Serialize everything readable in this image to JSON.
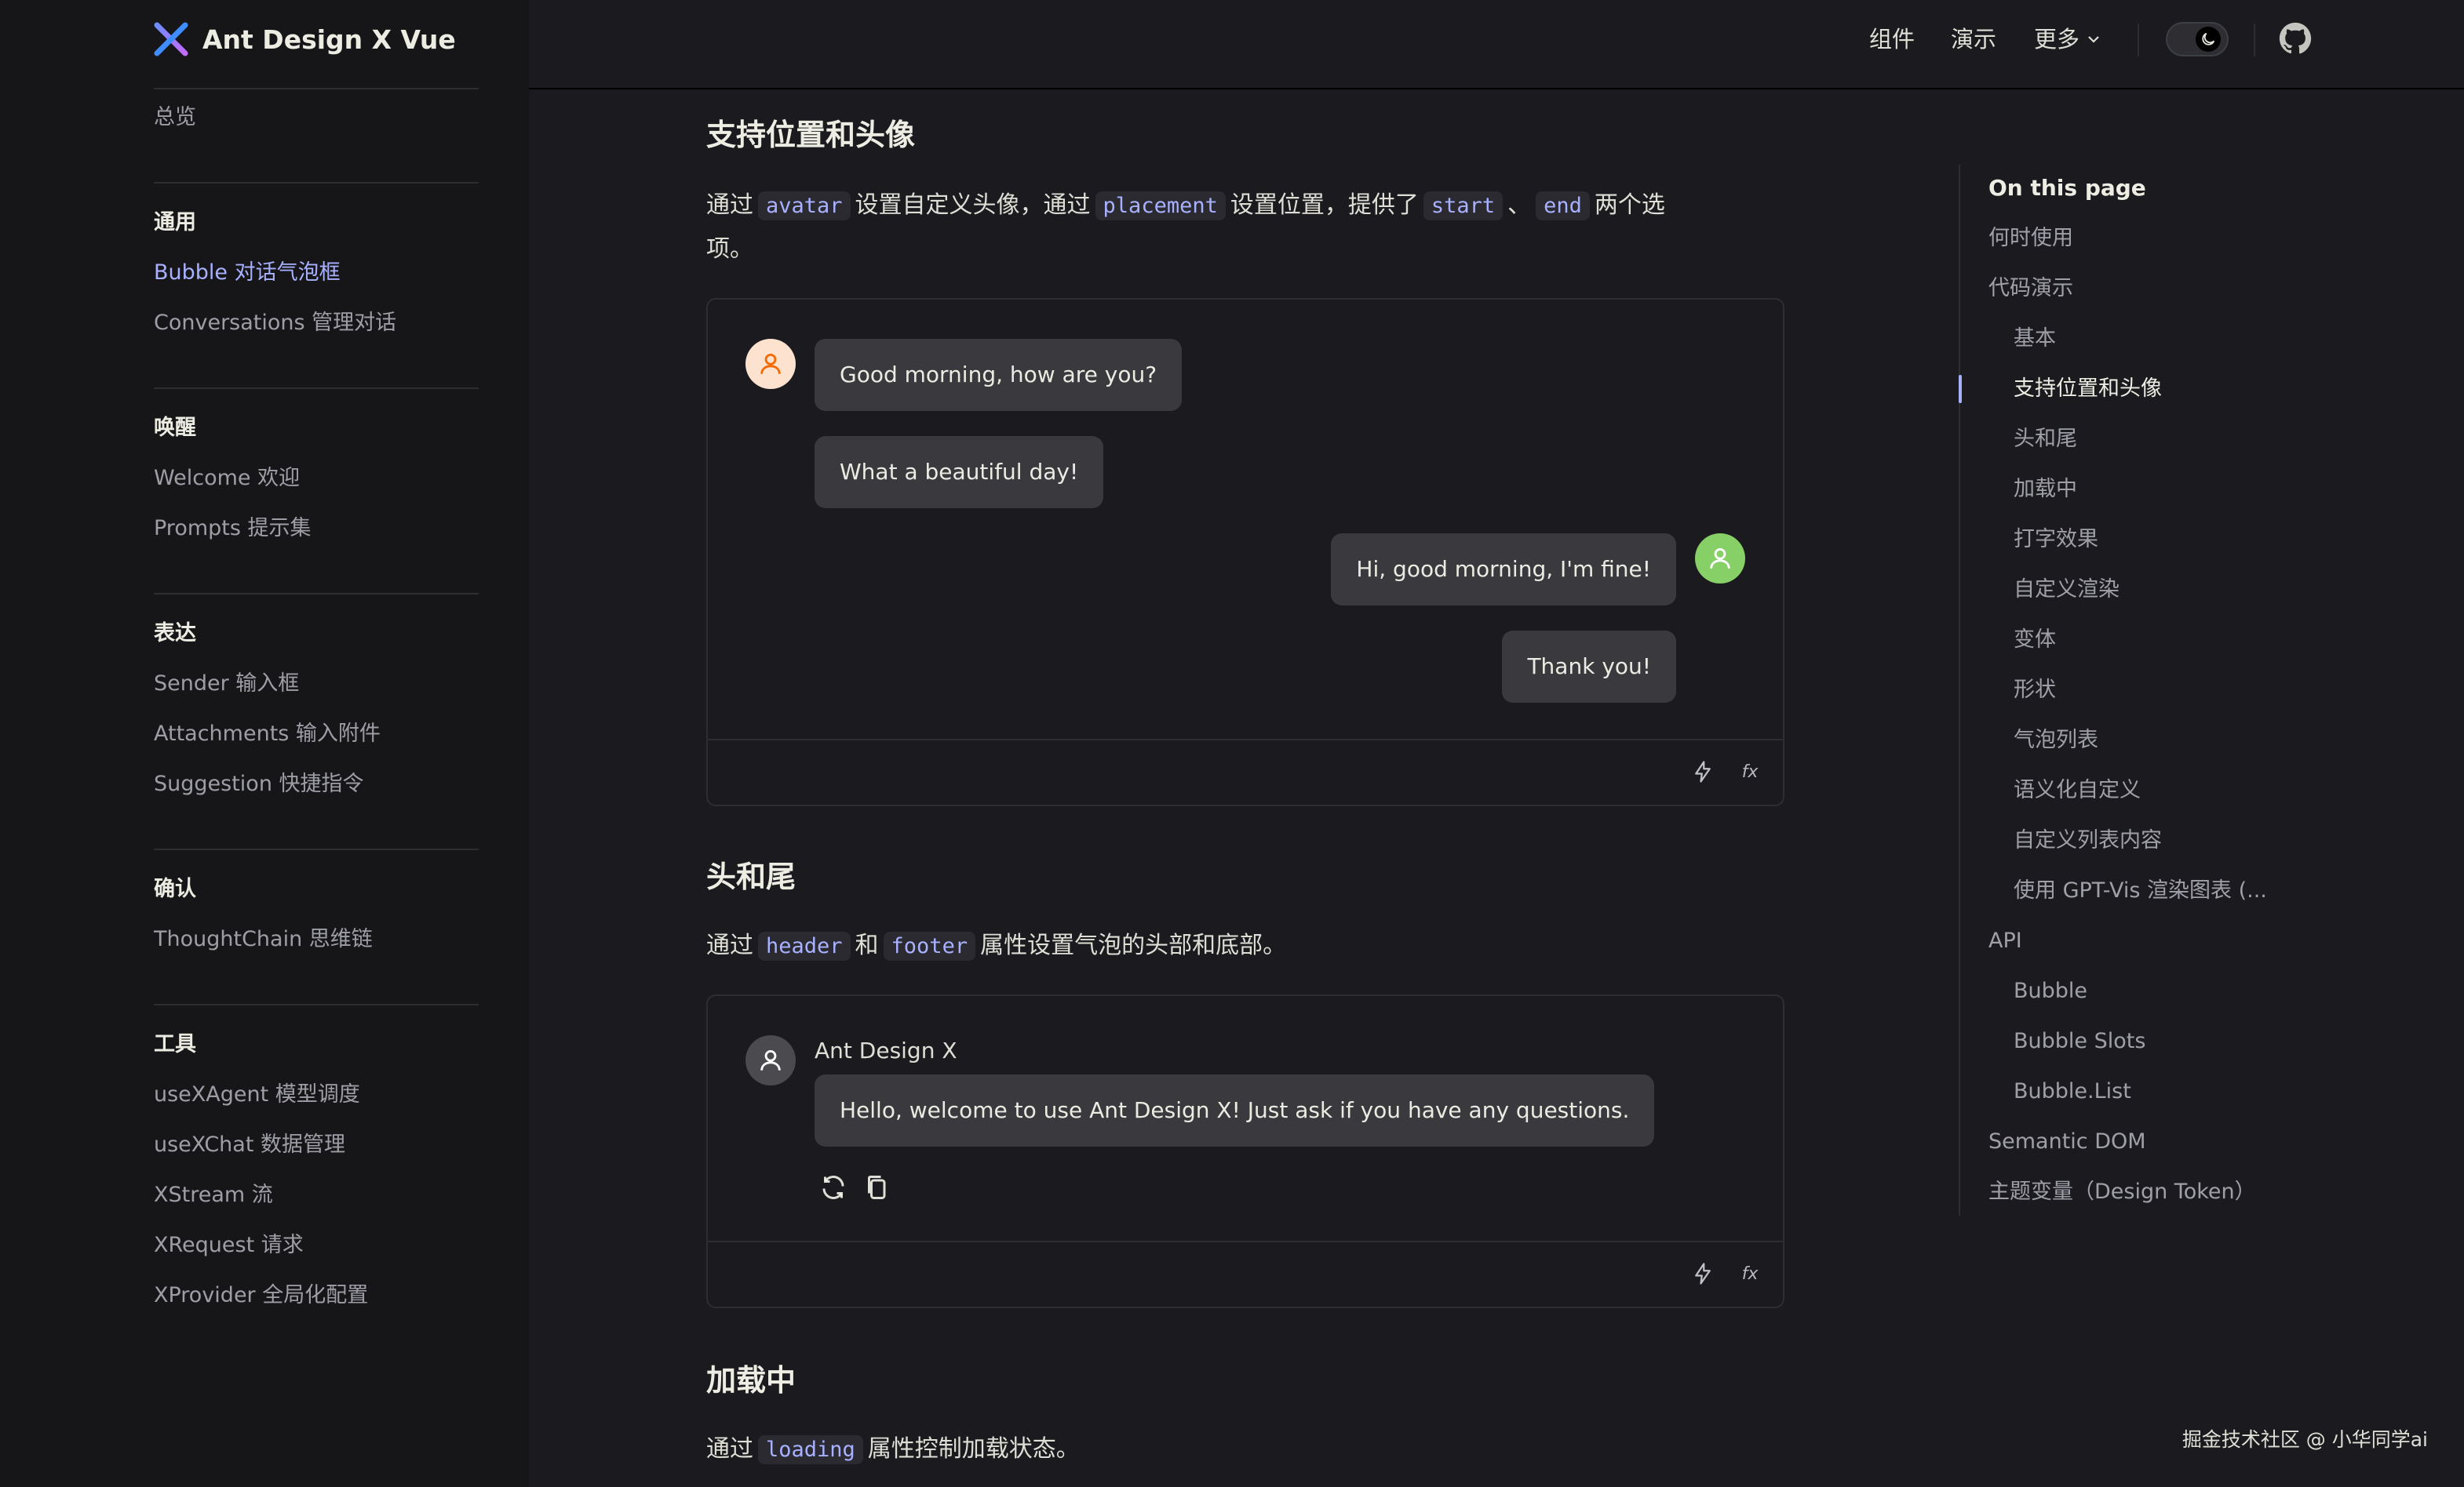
{
  "app": {
    "title": "Ant Design X Vue",
    "logo_icon": "ant-x-logo"
  },
  "sidebar": {
    "overview": "总览",
    "groups": [
      {
        "title": "通用",
        "items": [
          "Bubble 对话气泡框",
          "Conversations 管理对话"
        ]
      },
      {
        "title": "唤醒",
        "items": [
          "Welcome 欢迎",
          "Prompts 提示集"
        ]
      },
      {
        "title": "表达",
        "items": [
          "Sender 输入框",
          "Attachments 输入附件",
          "Suggestion 快捷指令"
        ]
      },
      {
        "title": "确认",
        "items": [
          "ThoughtChain 思维链"
        ]
      },
      {
        "title": "工具",
        "items": [
          "useXAgent 模型调度",
          "useXChat 数据管理",
          "XStream 流",
          "XRequest 请求",
          "XProvider 全局化配置"
        ]
      }
    ],
    "active_item": "Bubble 对话气泡框"
  },
  "topnav": {
    "items": [
      "组件",
      "演示",
      "更多"
    ],
    "theme_toggle_icon": "moon-icon",
    "github_icon": "github-icon"
  },
  "sections": {
    "placement": {
      "title": "支持位置和头像",
      "desc_1": "通过",
      "code_1": "avatar",
      "desc_2": "设置自定义头像，通过",
      "code_2": "placement",
      "desc_3": "设置位置，提供了",
      "code_3": "start",
      "desc_4": "、",
      "code_4": "end",
      "desc_5": "两个选",
      "desc_6": "项。",
      "messages": [
        "Good morning, how are you?",
        "What a beautiful day!",
        "Hi, good morning, I'm fine!",
        "Thank you!"
      ]
    },
    "header_footer": {
      "title": "头和尾",
      "desc_1": "通过",
      "code_1": "header",
      "desc_2": "和",
      "code_2": "footer",
      "desc_3": "属性设置气泡的头部和底部。",
      "header_text": "Ant Design X",
      "message": "Hello, welcome to use Ant Design X! Just ask if you have any questions."
    },
    "loading": {
      "title": "加载中",
      "desc_1": "通过",
      "code_1": "loading",
      "desc_2": "属性控制加载状态。"
    },
    "demo_footer_fx": "fx"
  },
  "toc": {
    "title": "On this page",
    "items": [
      "何时使用",
      "代码演示",
      "基本",
      "支持位置和头像",
      "头和尾",
      "加载中",
      "打字效果",
      "自定义渲染",
      "变体",
      "形状",
      "气泡列表",
      "语义化自定义",
      "自定义列表内容",
      "使用 GPT-Vis 渲染图表 (...",
      "API",
      "Bubble",
      "Bubble Slots",
      "Bubble.List",
      "Semantic DOM",
      "主题变量（Design Token）"
    ],
    "active": "支持位置和头像"
  },
  "watermark": "掘金技术社区 @ 小华同学ai",
  "colors": {
    "accent": "#a8b1ff",
    "avatar_orange": "#fde3cf",
    "avatar_green": "#87d068",
    "avatar_gray": "#4a4a4f"
  }
}
